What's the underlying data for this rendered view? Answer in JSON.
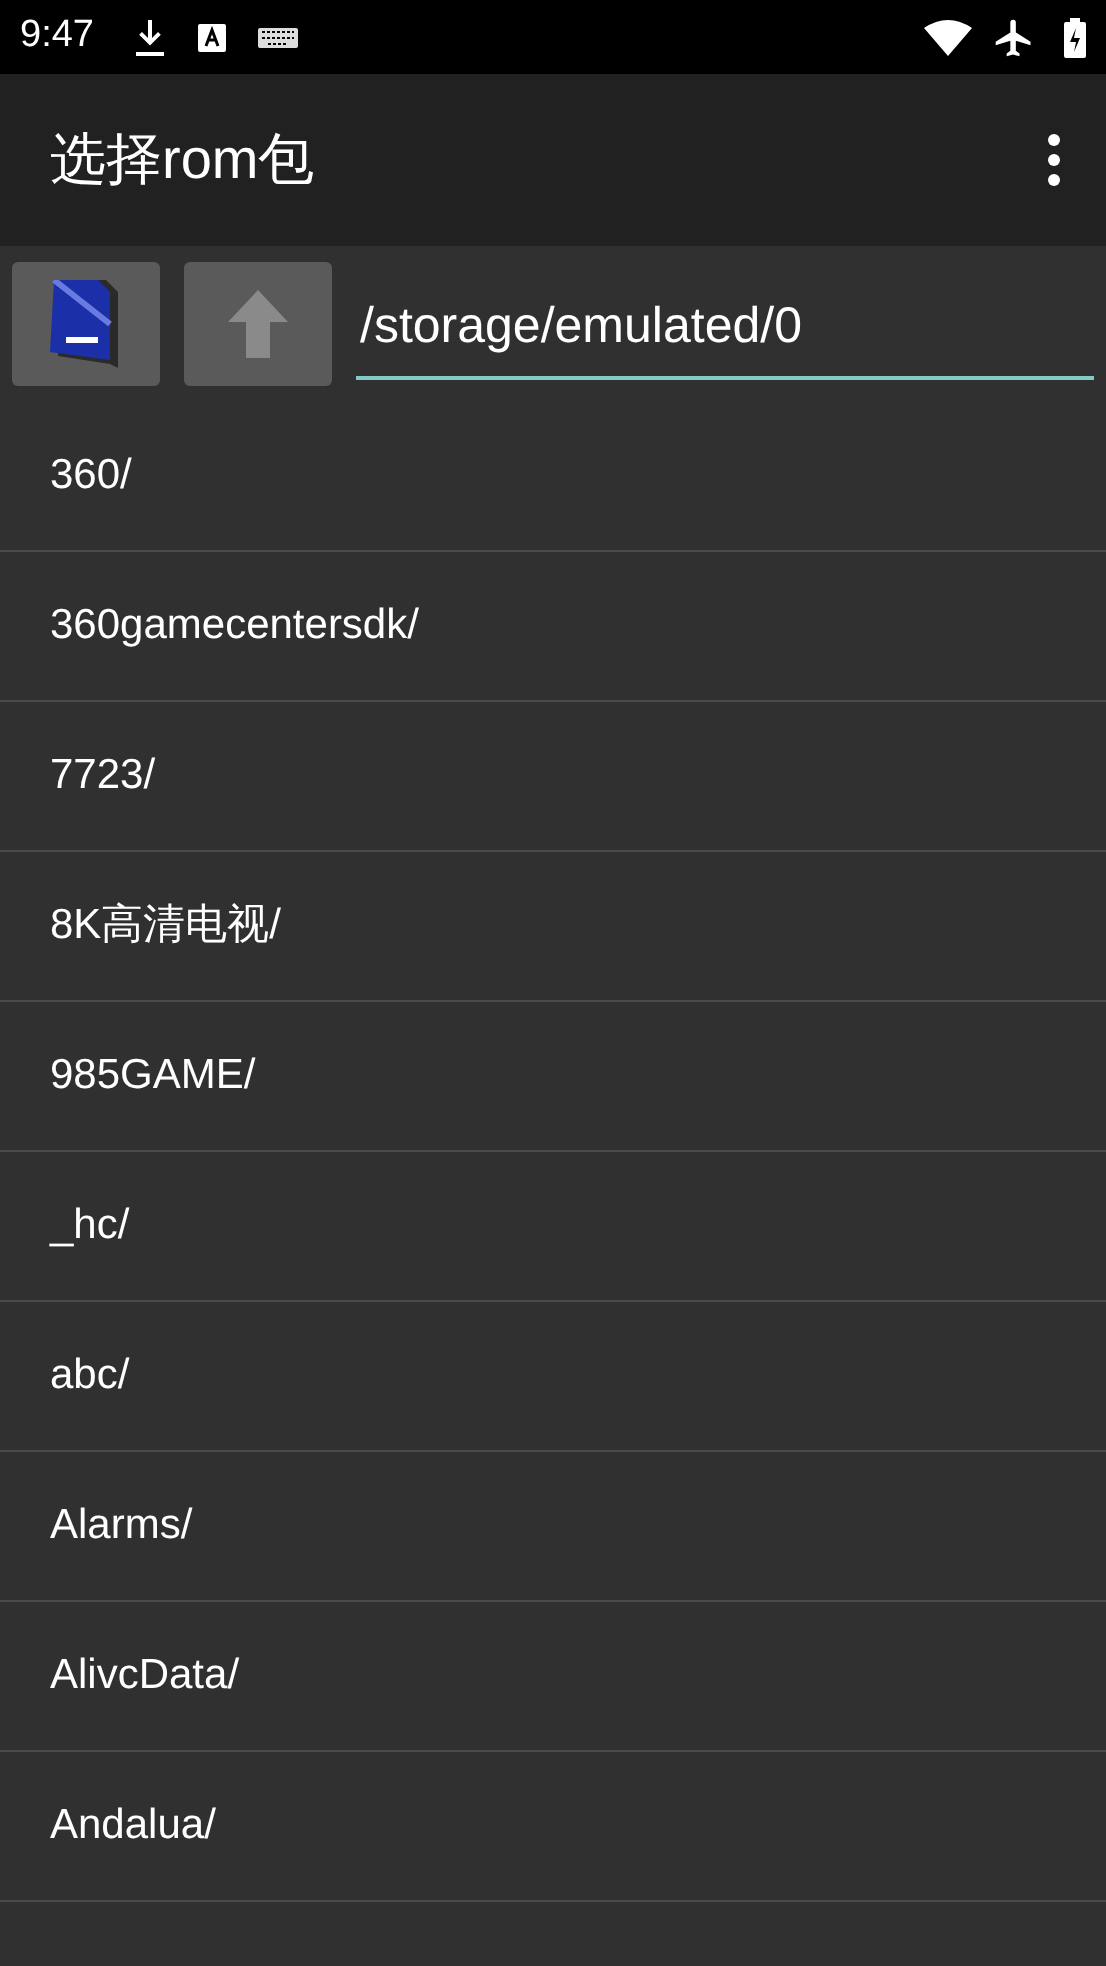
{
  "status_bar": {
    "time": "9:47"
  },
  "app_bar": {
    "title": "选择rom包"
  },
  "path_bar": {
    "up_disabled": true,
    "path": "/storage/emulated/0"
  },
  "files": [
    {
      "name": "360/"
    },
    {
      "name": "360gamecentersdk/"
    },
    {
      "name": "7723/"
    },
    {
      "name": "8K高清电视/"
    },
    {
      "name": "985GAME/"
    },
    {
      "name": "_hc/"
    },
    {
      "name": "abc/"
    },
    {
      "name": "Alarms/"
    },
    {
      "name": "AlivcData/"
    },
    {
      "name": "Andalua/"
    }
  ]
}
